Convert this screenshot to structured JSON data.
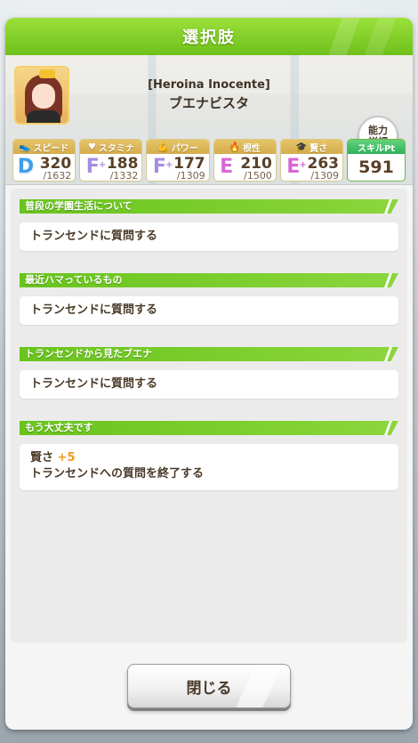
{
  "dialog": {
    "title": "選択肢"
  },
  "character": {
    "epithet": "[Heroina Inocente]",
    "name": "ブエナビスタ"
  },
  "detail_button": {
    "label": "能力\n詳細"
  },
  "stats": [
    {
      "label": "スピード",
      "icon": "shoe-icon",
      "grade": "D",
      "plus": "",
      "value": "320",
      "max": "/1632"
    },
    {
      "label": "スタミナ",
      "icon": "heart-icon",
      "grade": "F",
      "plus": "+",
      "value": "188",
      "max": "/1332"
    },
    {
      "label": "パワー",
      "icon": "muscle-icon",
      "grade": "F",
      "plus": "+",
      "value": "177",
      "max": "/1309"
    },
    {
      "label": "根性",
      "icon": "flame-icon",
      "grade": "E",
      "plus": "",
      "value": "210",
      "max": "/1500"
    },
    {
      "label": "賢さ",
      "icon": "graduation-cap-icon",
      "grade": "E",
      "plus": "+",
      "value": "263",
      "max": "/1309"
    }
  ],
  "skill_pt": {
    "label": "スキルPt",
    "value": "591"
  },
  "choices": [
    {
      "header": "普段の学園生活について",
      "text": "トランセンドに質問する"
    },
    {
      "header": "最近ハマっているもの",
      "text": "トランセンドに質問する"
    },
    {
      "header": "トランセンドから見たブエナ",
      "text": "トランセンドに質問する"
    },
    {
      "header": "もう大丈夫です",
      "effect_label": "賢さ",
      "effect_bonus": "+5",
      "text": "トランセンドへの質問を終了する"
    }
  ],
  "close_button": {
    "label": "閉じる"
  },
  "colors": {
    "header_green": "#7cc923",
    "accent_orange": "#f29a16",
    "grade_D": "#3b9ff0",
    "grade_F": "#a78be0",
    "grade_E": "#d768d4"
  }
}
